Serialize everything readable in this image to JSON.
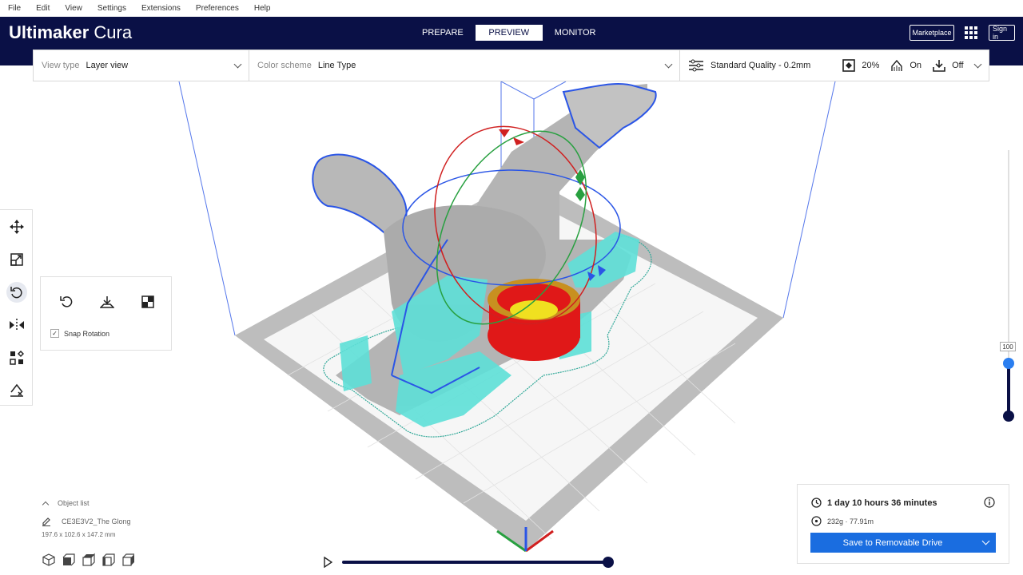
{
  "menubar": {
    "items": [
      "File",
      "Edit",
      "View",
      "Settings",
      "Extensions",
      "Preferences",
      "Help"
    ]
  },
  "header": {
    "logo_bold": "Ultimaker",
    "logo_light": " Cura",
    "tabs": [
      {
        "label": "PREPARE",
        "active": false
      },
      {
        "label": "PREVIEW",
        "active": true
      },
      {
        "label": "MONITOR",
        "active": false
      }
    ],
    "marketplace_label": "Marketplace",
    "signin_label": "Sign in"
  },
  "settings_bar": {
    "view_type_label": "View type",
    "view_type_value": "Layer view",
    "color_scheme_label": "Color scheme",
    "color_scheme_value": "Line Type",
    "quality": "Standard Quality - 0.2mm",
    "infill": "20%",
    "support": "On",
    "adhesion": "Off"
  },
  "rotate_panel": {
    "snap_label": "Snap Rotation",
    "snap_checked": true
  },
  "object_list": {
    "toggle_label": "Object list",
    "object_name": "CE3E3V2_The Glong",
    "dimensions": "197.6 x 102.6 x 147.2 mm"
  },
  "print_info": {
    "time": "1 day 10 hours 36 minutes",
    "material": "232g · 77.91m",
    "save_label": "Save to Removable Drive"
  },
  "layer_slider": {
    "value": "100"
  },
  "colors": {
    "header_bg": "#0a1046",
    "accent_blue": "#1a6de0",
    "support_cyan": "#5ee0d8",
    "wall_red": "#e01818",
    "model_gray": "#b4b4b4"
  }
}
